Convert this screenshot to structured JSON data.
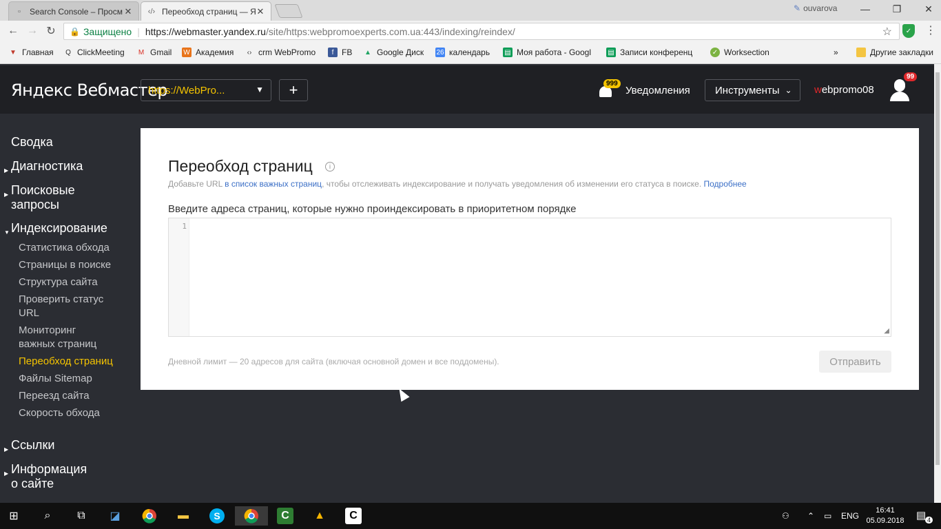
{
  "browser": {
    "tabs": [
      {
        "title": "Search Console – Просм",
        "active": false
      },
      {
        "title": "Переобход страниц — Я",
        "active": true
      }
    ],
    "profile": "ouvarova",
    "window_controls": [
      "—",
      "❐",
      "✕"
    ],
    "address": {
      "secure_label": "Защищено",
      "host": "https://webmaster.yandex.ru",
      "path": "/site/https:webpromoexperts.com.ua:443/indexing/reindex/"
    },
    "bookmarks": [
      {
        "label": "Главная",
        "color": "#c0392b"
      },
      {
        "label": "ClickMeeting",
        "color": "#333333"
      },
      {
        "label": "Gmail",
        "color": "#d93025"
      },
      {
        "label": "Академия",
        "color": "#e8741a"
      },
      {
        "label": "crm WebPromo",
        "color": "#333333"
      },
      {
        "label": "FB",
        "color": "#3b5998"
      },
      {
        "label": "Google Диск",
        "color": "#1fa463"
      },
      {
        "label": "календарь",
        "color": "#4285f4"
      },
      {
        "label": "Моя работа - Googl",
        "color": "#0f9d58"
      },
      {
        "label": "Записи конференц",
        "color": "#0f9d58"
      },
      {
        "label": "Worksection",
        "color": "#7cb342"
      }
    ],
    "bookmarks_more": "»",
    "other_bookmarks": "Другие закладки"
  },
  "header": {
    "logo_bold": "Яндекс",
    "logo_thin": "Вебмастер",
    "site_select": "https://WebPro...",
    "add_label": "+",
    "notif_count": "999",
    "notif_label": "Уведомления",
    "tools_label": "Инструменты",
    "user_first_letter": "w",
    "user_rest": "ebpromo08",
    "user_badge": "99"
  },
  "sidebar": {
    "top": [
      {
        "label": "Сводка",
        "arrow": ""
      },
      {
        "label": "Диагностика",
        "arrow": "▶"
      },
      {
        "label": "Поисковые\nзапросы",
        "arrow": "▶"
      },
      {
        "label": "Индексирование",
        "arrow": "▼"
      }
    ],
    "sub": [
      {
        "label": "Статистика обхода"
      },
      {
        "label": "Страницы в поиске"
      },
      {
        "label": "Структура сайта"
      },
      {
        "label": "Проверить статус\nURL"
      },
      {
        "label": "Мониторинг\nважных страниц"
      },
      {
        "label": "Переобход страниц",
        "active": true
      },
      {
        "label": "Файлы Sitemap"
      },
      {
        "label": "Переезд сайта"
      },
      {
        "label": "Скорость обхода"
      }
    ],
    "bottom": [
      {
        "label": "Ссылки",
        "arrow": "▶"
      },
      {
        "label": "Информация\nо сайте",
        "arrow": "▶"
      }
    ]
  },
  "main": {
    "title": "Переобход страниц",
    "subtitle_pre": "Добавьте URL ",
    "subtitle_link": "в список важных страниц",
    "subtitle_mid": ", чтобы отслеживать индексирование и получать уведомления об изменении его статуса в поиске. ",
    "subtitle_more": "Подробнее",
    "field_label": "Введите адреса страниц, которые нужно проиндексировать в приоритетном порядке",
    "line_number": "1",
    "limit_text": "Дневной лимит — 20 адресов для сайта (включая основной домен и все поддомены).",
    "send_label": "Отправить"
  },
  "taskbar": {
    "lang": "ENG",
    "time": "16:41",
    "date": "05.09.2018",
    "action_badge": "4"
  }
}
